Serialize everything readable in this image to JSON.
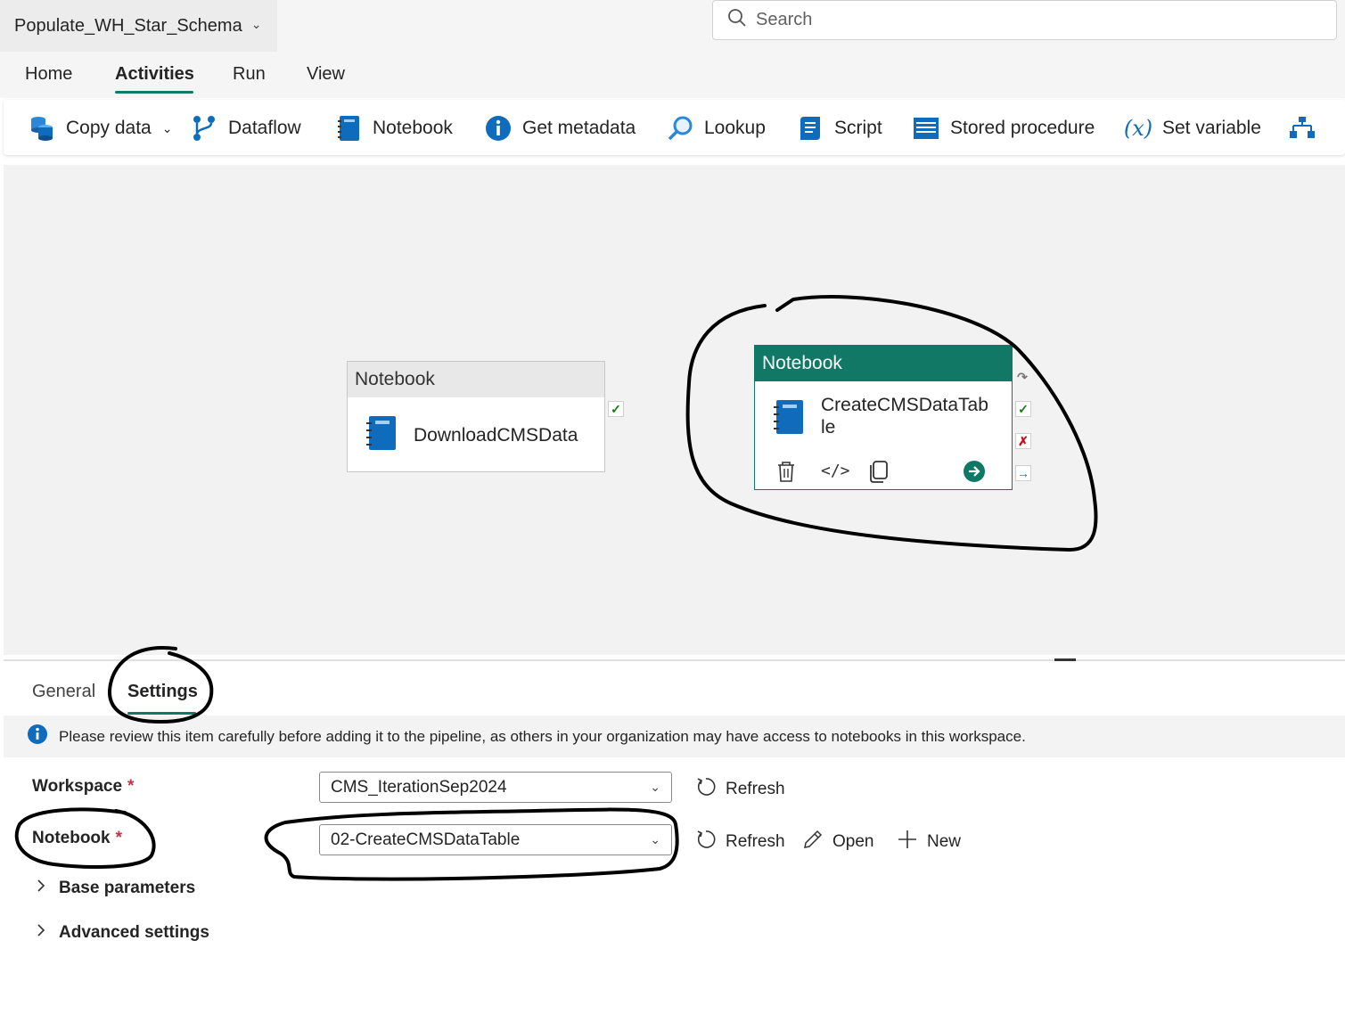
{
  "header": {
    "pipeline_name": "Populate_WH_Star_Schema",
    "search_placeholder": "Search"
  },
  "menu": {
    "tabs": [
      "Home",
      "Activities",
      "Run",
      "View"
    ],
    "active_tab": "Activities"
  },
  "toolbar": {
    "items": [
      {
        "label": "Copy data",
        "icon": "copy-data-icon",
        "has_dropdown": true
      },
      {
        "label": "Dataflow",
        "icon": "dataflow-icon"
      },
      {
        "label": "Notebook",
        "icon": "notebook-icon"
      },
      {
        "label": "Get metadata",
        "icon": "info-icon"
      },
      {
        "label": "Lookup",
        "icon": "lookup-icon"
      },
      {
        "label": "Script",
        "icon": "script-icon"
      },
      {
        "label": "Stored procedure",
        "icon": "stored-procedure-icon"
      },
      {
        "label": "Set variable",
        "icon": "variable-icon"
      }
    ]
  },
  "canvas": {
    "nodes": [
      {
        "type": "Notebook",
        "name": "DownloadCMSData",
        "selected": false
      },
      {
        "type": "Notebook",
        "name_line1": "CreateCMSDataTab",
        "name_line2": "le",
        "selected": true
      }
    ]
  },
  "panel": {
    "tabs": [
      "General",
      "Settings"
    ],
    "active_tab": "Settings",
    "info_message": "Please review this item carefully before adding it to the pipeline, as others in your organization may have access to notebooks in this workspace.",
    "workspace": {
      "label": "Workspace",
      "required_mark": "*",
      "value": "CMS_IterationSep2024",
      "refresh_label": "Refresh"
    },
    "notebook": {
      "label": "Notebook",
      "required_mark": "*",
      "value": "02-CreateCMSDataTable",
      "refresh_label": "Refresh",
      "open_label": "Open",
      "new_label": "New"
    },
    "expanders": [
      "Base parameters",
      "Advanced settings"
    ]
  },
  "colors": {
    "accent": "#117865",
    "info_blue": "#0f6cbd",
    "success_green": "#107c10",
    "fail_red": "#c50f1f"
  }
}
